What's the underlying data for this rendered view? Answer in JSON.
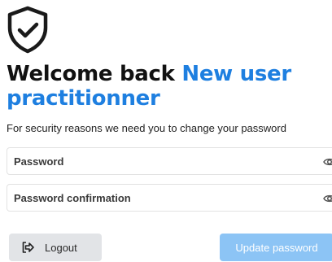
{
  "header": {
    "title_prefix": "Welcome back",
    "title_name": "New user practitionner",
    "subtitle": "For security reasons we need you to change your password"
  },
  "form": {
    "password_placeholder": "Password",
    "password_confirmation_placeholder": "Password confirmation"
  },
  "actions": {
    "logout_label": "Logout",
    "update_label": "Update password"
  },
  "colors": {
    "accent": "#1e7fe0",
    "update_button": "#8cc4f5",
    "logout_button": "#e2e4e7"
  },
  "icons": {
    "logo": "shield-check-icon",
    "password_toggle": "eye-icon",
    "logout": "logout-icon"
  }
}
